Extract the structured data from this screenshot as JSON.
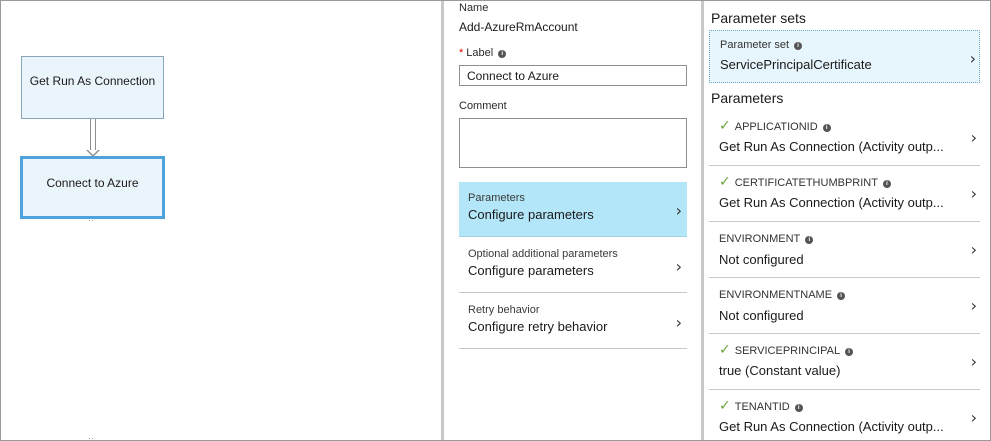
{
  "canvas": {
    "nodes": [
      {
        "label": "Get Run As Connection"
      },
      {
        "label": "Connect to Azure"
      }
    ]
  },
  "properties": {
    "name_label": "Name",
    "name_value": "Add-AzureRmAccount",
    "label_label": "Label",
    "label_value": "Connect to Azure",
    "comment_label": "Comment",
    "menu": [
      {
        "title": "Parameters",
        "subtitle": "Configure parameters"
      },
      {
        "title": "Optional additional parameters",
        "subtitle": "Configure parameters"
      },
      {
        "title": "Retry behavior",
        "subtitle": "Configure retry behavior"
      }
    ]
  },
  "parameters_panel": {
    "parameter_sets_title": "Parameter sets",
    "parameter_set_label": "Parameter set",
    "parameter_set_value": "ServicePrincipalCertificate",
    "parameters_title": "Parameters",
    "items": [
      {
        "name": "APPLICATIONID",
        "value": "Get Run As Connection (Activity outp...",
        "configured": true
      },
      {
        "name": "CERTIFICATETHUMBPRINT",
        "value": "Get Run As Connection (Activity outp...",
        "configured": true
      },
      {
        "name": "ENVIRONMENT",
        "value": "Not configured",
        "configured": false
      },
      {
        "name": "ENVIRONMENTNAME",
        "value": "Not configured",
        "configured": false
      },
      {
        "name": "SERVICEPRINCIPAL",
        "value": "true (Constant value)",
        "configured": true
      },
      {
        "name": "TENANTID",
        "value": "Get Run As Connection (Activity outp...",
        "configured": true
      }
    ]
  },
  "colors": {
    "active_menu_bg": "#b3e6f8",
    "selected_node_border": "#4fa3dc",
    "check_color": "#6aa73a",
    "required_color": "#e00000"
  }
}
